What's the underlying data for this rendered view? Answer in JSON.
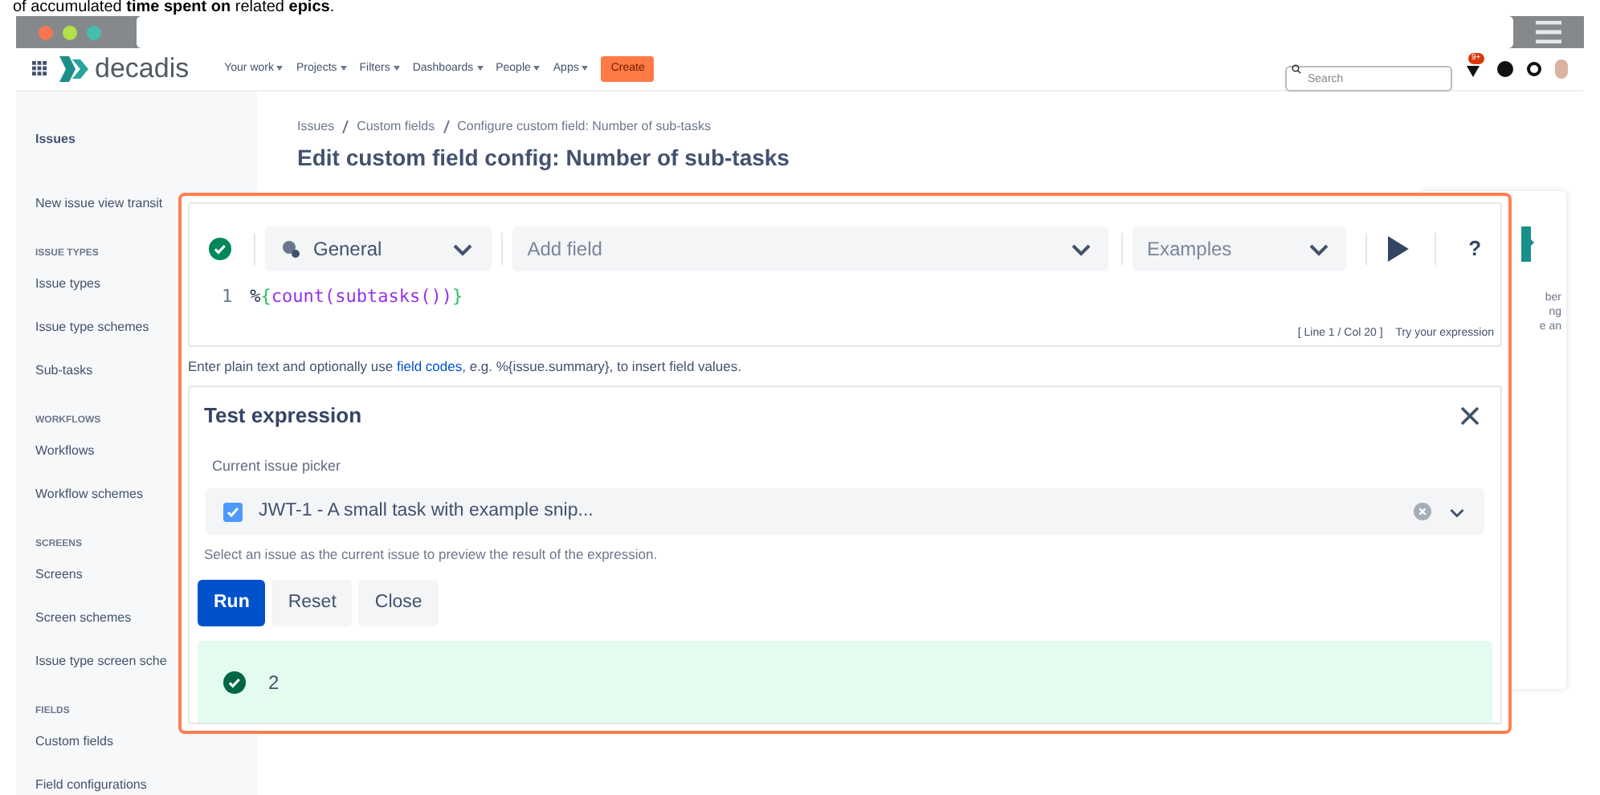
{
  "caption": "of accumulated **time spent on** related **epics**.",
  "nav": {
    "logo": "decadis",
    "menu": [
      {
        "label": "Your work"
      },
      {
        "label": "Projects"
      },
      {
        "label": "Filters"
      },
      {
        "label": "Dashboards"
      },
      {
        "label": "People"
      },
      {
        "label": "Apps"
      }
    ],
    "create": "Create",
    "search": {
      "placeholder": "Search"
    },
    "notification_badge": "9+"
  },
  "sidebar": {
    "items": [
      {
        "kind": "title",
        "label": "Issues"
      },
      {
        "kind": "link",
        "label": "New issue view transit"
      },
      {
        "kind": "heading",
        "label": "ISSUE TYPES"
      },
      {
        "kind": "link",
        "label": "Issue types"
      },
      {
        "kind": "link",
        "label": "Issue type schemes"
      },
      {
        "kind": "link",
        "label": "Sub-tasks"
      },
      {
        "kind": "heading",
        "label": "WORKFLOWS"
      },
      {
        "kind": "link",
        "label": "Workflows"
      },
      {
        "kind": "link",
        "label": "Workflow schemes"
      },
      {
        "kind": "heading",
        "label": "SCREENS"
      },
      {
        "kind": "link",
        "label": "Screens"
      },
      {
        "kind": "link",
        "label": "Screen schemes"
      },
      {
        "kind": "link",
        "label": "Issue type screen sche"
      },
      {
        "kind": "heading",
        "label": "FIELDS"
      },
      {
        "kind": "link",
        "label": "Custom fields"
      },
      {
        "kind": "link",
        "label": "Field configurations"
      }
    ]
  },
  "breadcrumbs": [
    "Issues",
    "Custom fields",
    "Configure custom field: Number of sub-tasks"
  ],
  "title": "Edit custom field config: Number of sub-tasks",
  "side_card": {
    "lines": [
      "ber",
      "ng",
      "e an"
    ]
  },
  "editor": {
    "valid": true,
    "category": "General",
    "add_field": {
      "placeholder": "Add field"
    },
    "examples": {
      "placeholder": "Examples"
    },
    "help_button": "?",
    "lines": [
      {
        "number": "1",
        "tokens": [
          {
            "kind": "plain",
            "text": "%"
          },
          {
            "kind": "brace",
            "text": "{"
          },
          {
            "kind": "func",
            "text": "count("
          },
          {
            "kind": "func",
            "text": "subtasks()"
          },
          {
            "kind": "func",
            "text": ")"
          },
          {
            "kind": "brace",
            "text": "}"
          }
        ]
      }
    ],
    "cursor": "[ Line 1 / Col 20 ]",
    "try_link": "Try your expression",
    "hint_before": "Enter plain text and optionally use",
    "hint_link": "field codes",
    "hint_after": ", e.g. %{issue.summary}, to insert field values."
  },
  "test": {
    "title": "Test expression",
    "picker_label": "Current issue picker",
    "issue": "JWT-1 - A small task with example snip...",
    "issue_checked": true,
    "helper": "Select an issue as the current issue to preview the result of the expression.",
    "buttons": [
      {
        "label": "Run",
        "primary": true
      },
      {
        "label": "Reset",
        "primary": false
      },
      {
        "label": "Close",
        "primary": false
      }
    ],
    "result": {
      "success": true,
      "value": "2"
    }
  }
}
